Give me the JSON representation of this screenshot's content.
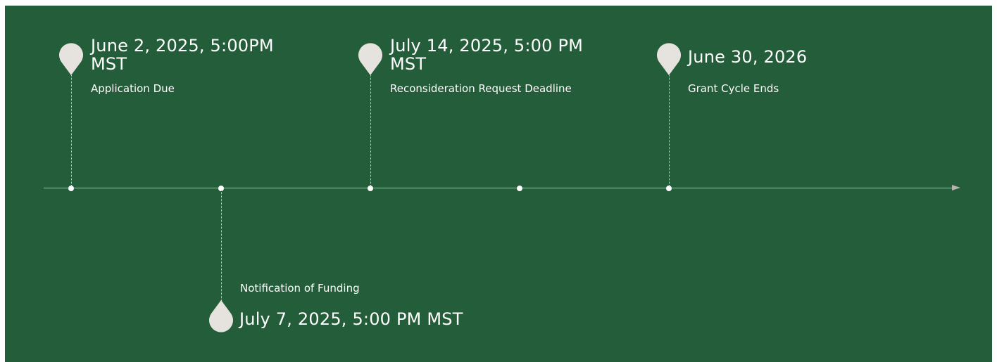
{
  "colors": {
    "background": "#235d39",
    "axis": "#b8b5ae",
    "pin": "#e6e3df",
    "text": "#ffffff"
  },
  "timeline": {
    "events": [
      {
        "date_line1": "June 2, 2025, 5:00PM",
        "date_line2": "MST",
        "label": "Application Due",
        "position": "above",
        "icon": "map-pin-icon"
      },
      {
        "date": "July 7, 2025, 5:00 PM MST",
        "label": "Notification of Funding",
        "position": "below",
        "icon": "map-pin-icon"
      },
      {
        "date_line1": "July 14, 2025, 5:00 PM",
        "date_line2": "MST",
        "label": "Reconsideration Request Deadline",
        "position": "above",
        "icon": "map-pin-icon"
      },
      {
        "date_line1": "June 30, 2026",
        "label": "Grant Cycle Ends",
        "position": "above",
        "icon": "map-pin-icon"
      }
    ]
  }
}
